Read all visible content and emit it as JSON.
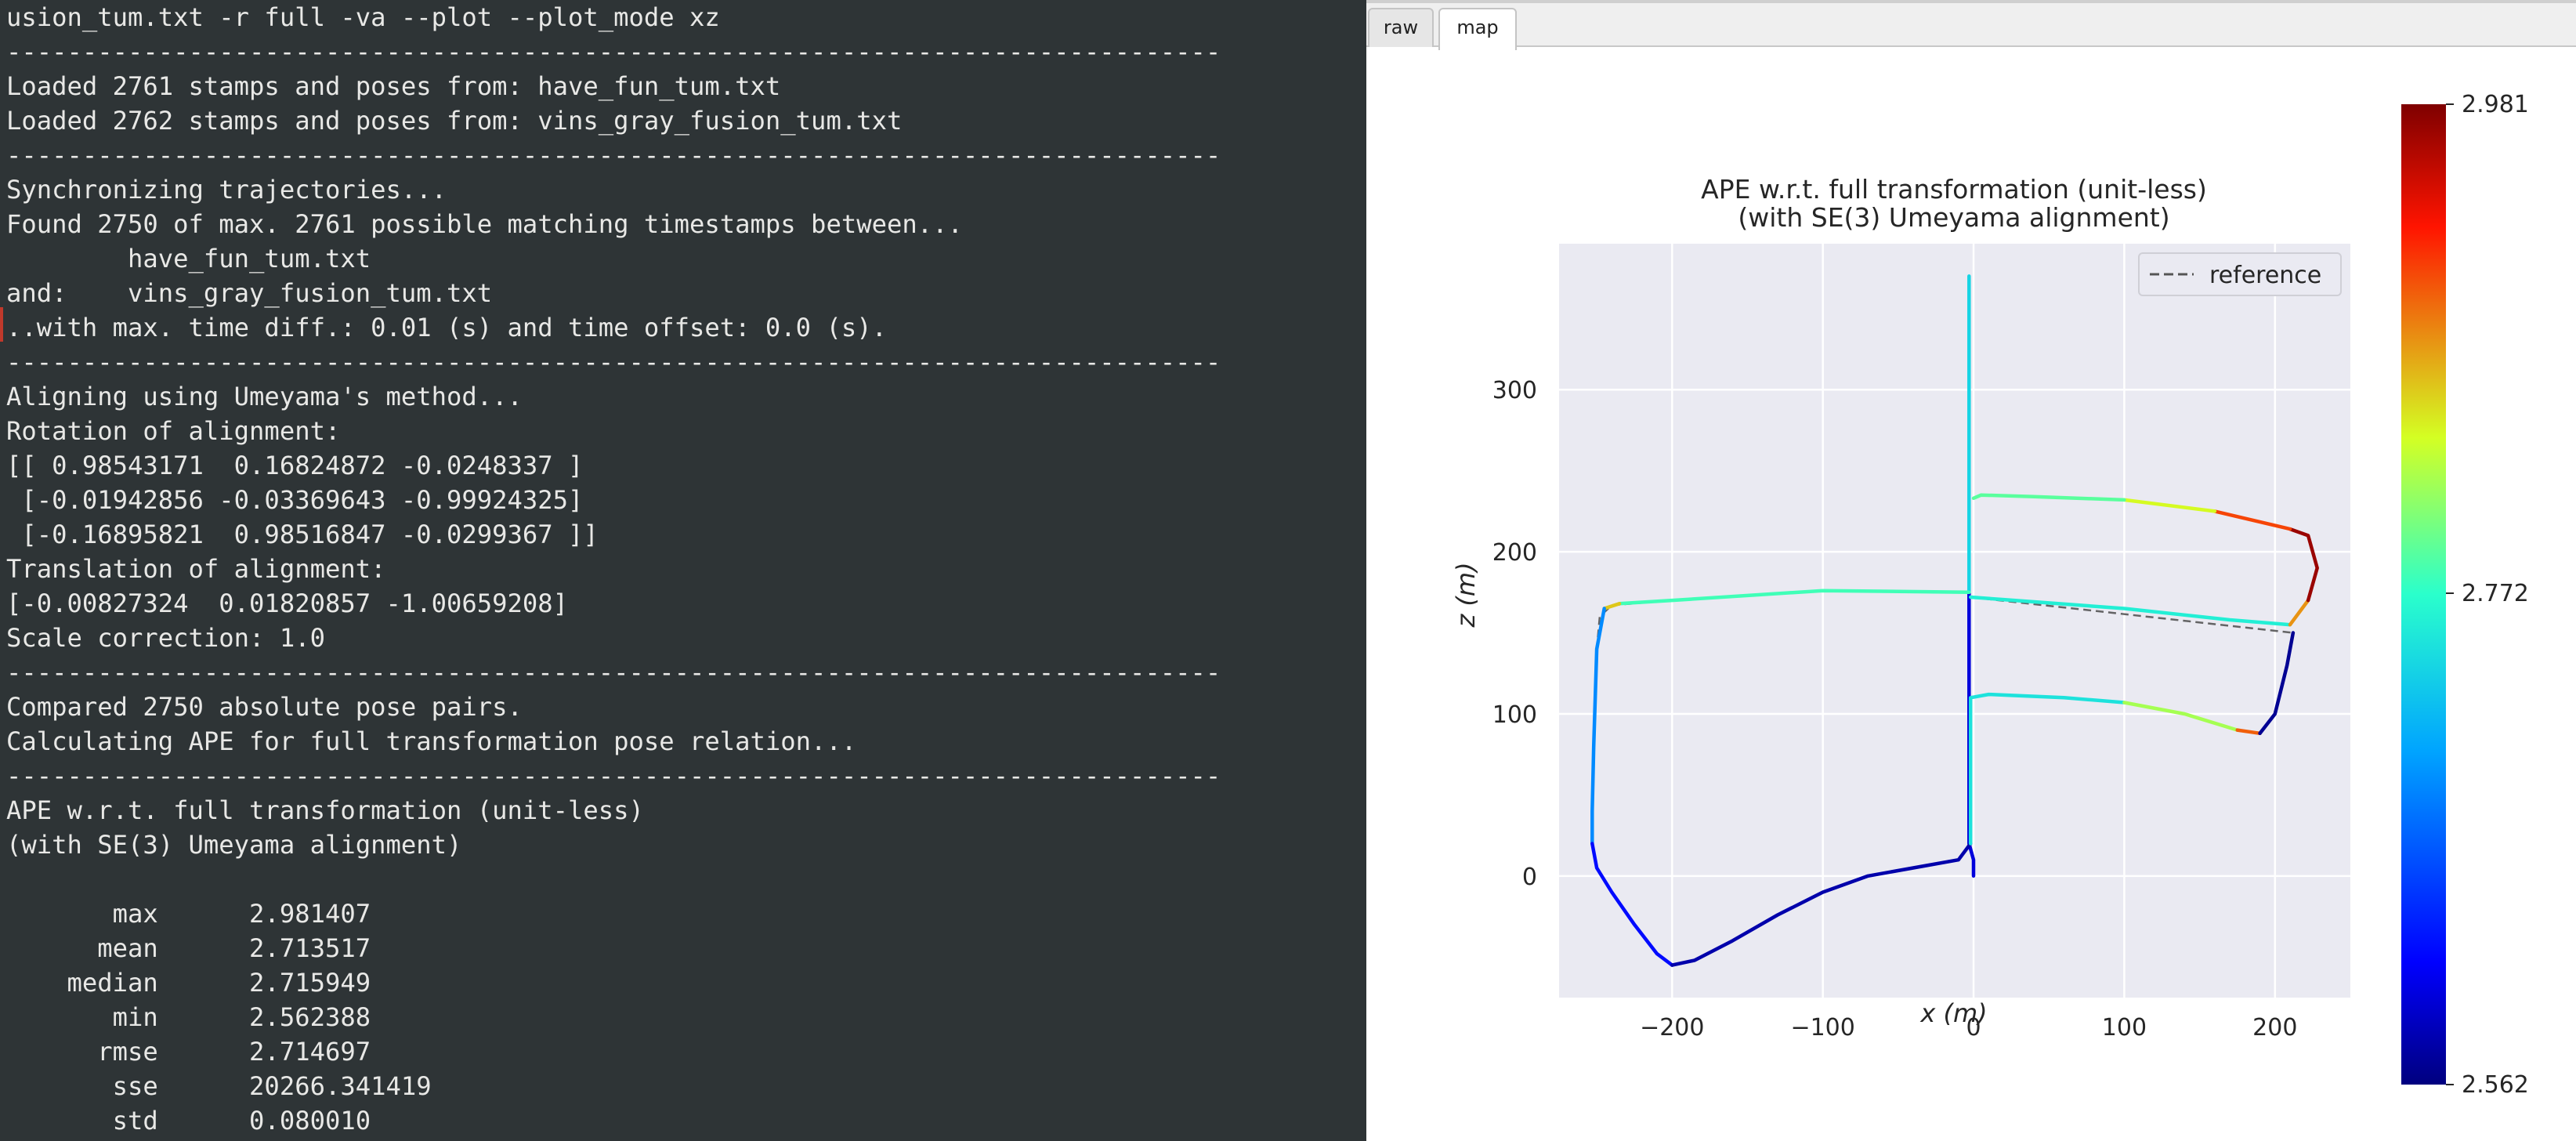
{
  "terminal": {
    "lines": [
      "usion_tum.txt -r full -va --plot --plot_mode xz",
      "--------------------------------------------------------------------------------",
      "Loaded 2761 stamps and poses from: have_fun_tum.txt",
      "Loaded 2762 stamps and poses from: vins_gray_fusion_tum.txt",
      "--------------------------------------------------------------------------------",
      "Synchronizing trajectories...",
      "Found 2750 of max. 2761 possible matching timestamps between...",
      "        have_fun_tum.txt",
      "and:    vins_gray_fusion_tum.txt",
      "..with max. time diff.: 0.01 (s) and time offset: 0.0 (s).",
      "--------------------------------------------------------------------------------",
      "Aligning using Umeyama's method...",
      "Rotation of alignment:",
      "[[ 0.98543171  0.16824872 -0.0248337 ]",
      " [-0.01942856 -0.03369643 -0.99924325]",
      " [-0.16895821  0.98516847 -0.0299367 ]]",
      "Translation of alignment:",
      "[-0.00827324  0.01820857 -1.00659208]",
      "Scale correction: 1.0",
      "--------------------------------------------------------------------------------",
      "Compared 2750 absolute pose pairs.",
      "Calculating APE for full transformation pose relation...",
      "--------------------------------------------------------------------------------",
      "APE w.r.t. full transformation (unit-less)",
      "(with SE(3) Umeyama alignment)",
      "",
      "       max      2.981407",
      "      mean      2.713517",
      "    median      2.715949",
      "       min      2.562388",
      "      rmse      2.714697",
      "       sse      20266.341419",
      "       std      0.080010"
    ]
  },
  "plot_window": {
    "tabs": [
      {
        "label": "raw",
        "active": false
      },
      {
        "label": "map",
        "active": true
      }
    ]
  },
  "chart_data": {
    "type": "line",
    "title": "APE w.r.t. full transformation (unit-less)",
    "subtitle": "(with SE(3) Umeyama alignment)",
    "xlabel": "x (m)",
    "ylabel": "z (m)",
    "xlim": [
      -275,
      250
    ],
    "ylim": [
      -75,
      390
    ],
    "xticks": [
      -200,
      -100,
      0,
      100,
      200
    ],
    "yticks": [
      0,
      100,
      200,
      300
    ],
    "grid": true,
    "legend": {
      "placement": "top-right",
      "entries": [
        "reference"
      ]
    },
    "colorbar": {
      "min": 2.562,
      "mid": 2.772,
      "max": 2.981,
      "colormap": "jet",
      "labels": [
        "2.981",
        "2.772",
        "2.562"
      ]
    },
    "series": [
      {
        "name": "reference",
        "style": "dashed",
        "color": "#555555",
        "points": [
          [
            0,
            0
          ],
          [
            0,
            10
          ],
          [
            -3,
            20
          ],
          [
            -3,
            60
          ],
          [
            -3,
            100
          ],
          [
            -3,
            150
          ],
          [
            -3,
            175
          ],
          [
            -3,
            200
          ],
          [
            -3,
            240
          ],
          [
            -3,
            280
          ],
          [
            -3,
            320
          ],
          [
            -3,
            370
          ],
          [
            -3,
            175
          ],
          [
            -100,
            176
          ],
          [
            -200,
            170
          ],
          [
            -240,
            167
          ],
          [
            -248,
            160
          ],
          [
            -250,
            140
          ],
          [
            -252,
            80
          ],
          [
            -253,
            40
          ],
          [
            -253,
            20
          ],
          [
            -250,
            5
          ],
          [
            -240,
            -10
          ],
          [
            -225,
            -30
          ],
          [
            -210,
            -48
          ],
          [
            -200,
            -55
          ],
          [
            -185,
            -52
          ],
          [
            -160,
            -40
          ],
          [
            -130,
            -24
          ],
          [
            -100,
            -10
          ],
          [
            -70,
            0
          ],
          [
            -40,
            5
          ],
          [
            -10,
            10
          ],
          [
            -2,
            20
          ],
          [
            -2,
            110
          ],
          [
            10,
            112
          ],
          [
            60,
            110
          ],
          [
            100,
            107
          ],
          [
            140,
            100
          ],
          [
            175,
            90
          ],
          [
            190,
            88
          ],
          [
            200,
            100
          ],
          [
            208,
            130
          ],
          [
            212,
            150
          ],
          [
            -2,
            172
          ],
          [
            100,
            165
          ],
          [
            170,
            158
          ],
          [
            210,
            155
          ],
          [
            222,
            170
          ],
          [
            228,
            190
          ],
          [
            222,
            210
          ],
          [
            210,
            214
          ],
          [
            160,
            225
          ],
          [
            100,
            232
          ],
          [
            40,
            234
          ],
          [
            5,
            235
          ],
          [
            0,
            233
          ]
        ]
      },
      {
        "name": "",
        "style": "colormapped",
        "segments": [
          {
            "points": [
              [
                0,
                0
              ],
              [
                0,
                10
              ],
              [
                -3,
                20
              ],
              [
                -3,
                60
              ],
              [
                -3,
                100
              ],
              [
                -3,
                150
              ],
              [
                -3,
                175
              ]
            ],
            "value": 2.6
          },
          {
            "points": [
              [
                -3,
                175
              ],
              [
                -3,
                200
              ],
              [
                -3,
                240
              ],
              [
                -3,
                280
              ],
              [
                -3,
                320
              ],
              [
                -3,
                370
              ]
            ],
            "value": 2.74
          },
          {
            "points": [
              [
                -3,
                175
              ],
              [
                -100,
                176
              ],
              [
                -200,
                170
              ],
              [
                -235,
                168
              ]
            ],
            "value": 2.78
          },
          {
            "points": [
              [
                -235,
                168
              ],
              [
                -245,
                165
              ]
            ],
            "value": 2.86
          },
          {
            "points": [
              [
                -245,
                165
              ],
              [
                -250,
                140
              ],
              [
                -252,
                80
              ],
              [
                -253,
                40
              ],
              [
                -253,
                20
              ]
            ],
            "value": 2.69
          },
          {
            "points": [
              [
                -253,
                20
              ],
              [
                -250,
                5
              ],
              [
                -240,
                -10
              ],
              [
                -225,
                -30
              ],
              [
                -210,
                -48
              ],
              [
                -200,
                -55
              ]
            ],
            "value": 2.62
          },
          {
            "points": [
              [
                -200,
                -55
              ],
              [
                -185,
                -52
              ],
              [
                -160,
                -40
              ],
              [
                -130,
                -24
              ],
              [
                -100,
                -10
              ],
              [
                -70,
                0
              ],
              [
                -40,
                5
              ],
              [
                -10,
                10
              ],
              [
                -2,
                20
              ]
            ],
            "value": 2.58
          },
          {
            "points": [
              [
                -2,
                20
              ],
              [
                -2,
                110
              ],
              [
                10,
                112
              ],
              [
                60,
                110
              ],
              [
                100,
                107
              ]
            ],
            "value": 2.75
          },
          {
            "points": [
              [
                100,
                107
              ],
              [
                140,
                100
              ],
              [
                175,
                90
              ]
            ],
            "value": 2.82
          },
          {
            "points": [
              [
                175,
                90
              ],
              [
                190,
                88
              ]
            ],
            "value": 2.9
          },
          {
            "points": [
              [
                190,
                88
              ],
              [
                200,
                100
              ],
              [
                208,
                130
              ],
              [
                212,
                150
              ]
            ],
            "value": 2.57
          },
          {
            "points": [
              [
                -2,
                172
              ],
              [
                100,
                165
              ],
              [
                170,
                158
              ],
              [
                210,
                155
              ]
            ],
            "value": 2.76
          },
          {
            "points": [
              [
                210,
                155
              ],
              [
                222,
                170
              ]
            ],
            "value": 2.88
          },
          {
            "points": [
              [
                222,
                170
              ],
              [
                228,
                190
              ],
              [
                222,
                210
              ],
              [
                210,
                214
              ]
            ],
            "value": 2.97
          },
          {
            "points": [
              [
                210,
                214
              ],
              [
                160,
                225
              ]
            ],
            "value": 2.91
          },
          {
            "points": [
              [
                160,
                225
              ],
              [
                100,
                232
              ]
            ],
            "value": 2.84
          },
          {
            "points": [
              [
                100,
                232
              ],
              [
                40,
                234
              ],
              [
                5,
                235
              ],
              [
                0,
                233
              ]
            ],
            "value": 2.79
          }
        ]
      }
    ]
  }
}
